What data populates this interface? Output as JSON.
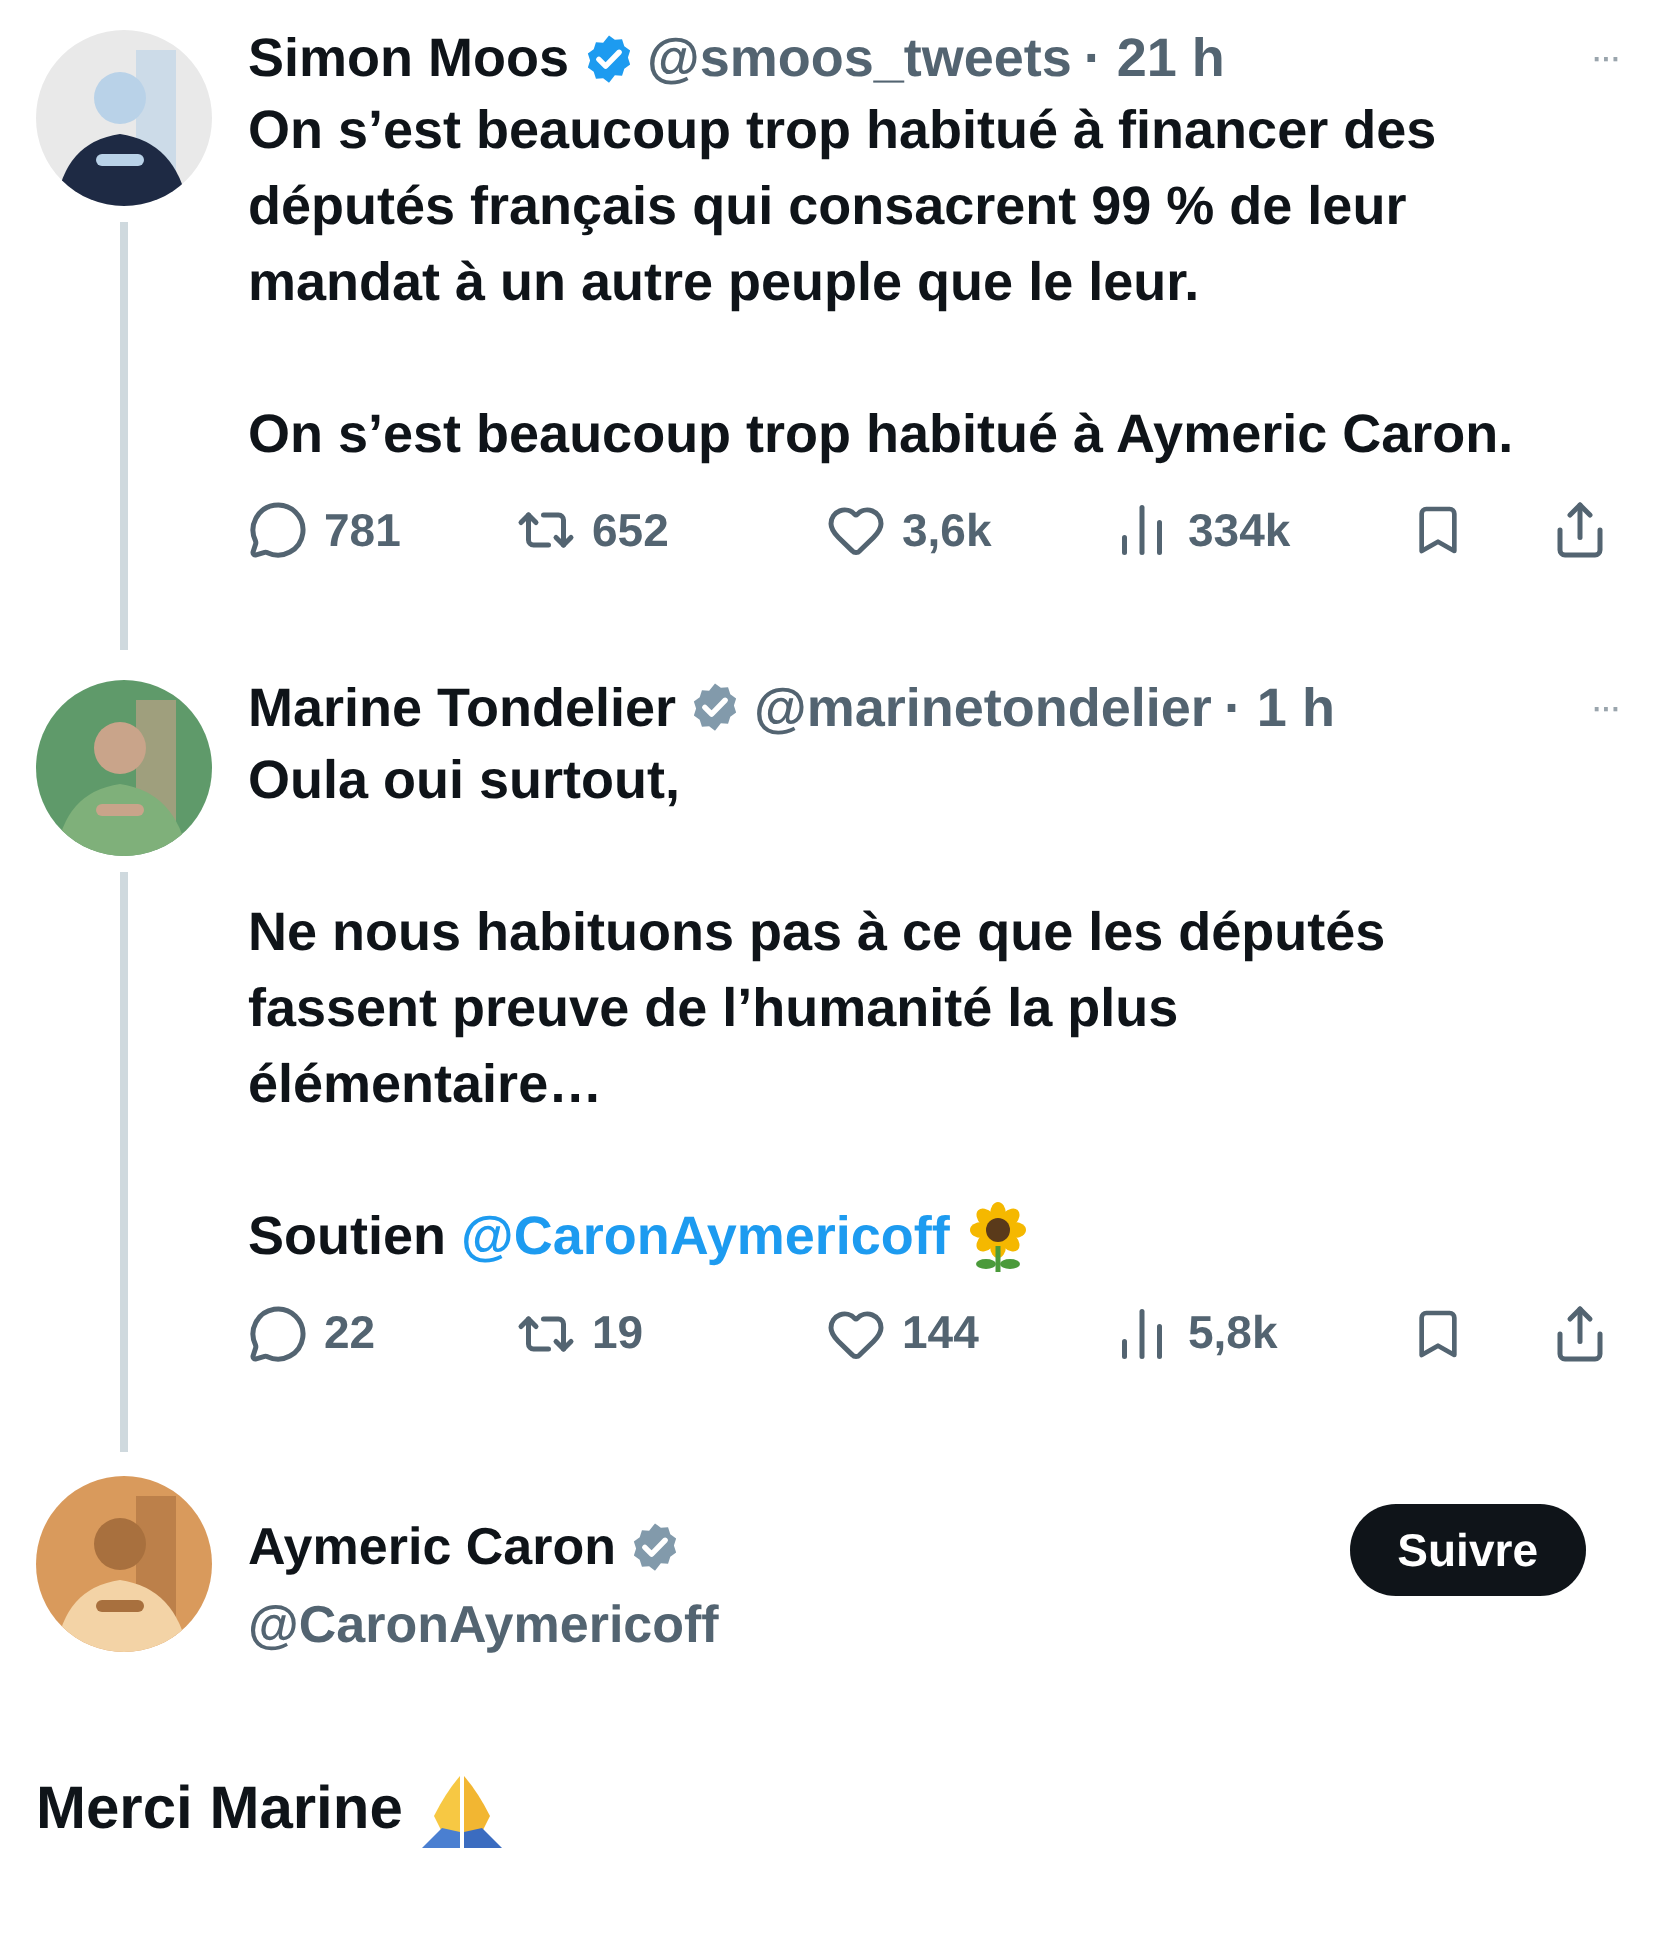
{
  "tweets": [
    {
      "name": "Simon Moos",
      "badge": {
        "kind": "blue"
      },
      "handle": "@smoos_tweets",
      "time": "· 21 h",
      "more": "···",
      "avatar": {
        "kind": "picture"
      },
      "paragraphs": [
        {
          "text": "On s’est beaucoup trop habitué à financer des députés français qui consacrent 99 % de leur mandat à un autre peuple que le leur."
        },
        {
          "text": "On s’est beaucoup trop habitué à Aymeric Caron."
        }
      ],
      "actions": {
        "replies": "781",
        "reposts": "652",
        "likes": "3,6k",
        "views": "334k"
      }
    },
    {
      "name": "Marine Tondelier",
      "badge": {
        "kind": "grey"
      },
      "handle": "@marinetondelier",
      "time": "· 1 h",
      "more": "···",
      "avatar": {
        "kind": "picture"
      },
      "paragraphs": [
        {
          "text": "Oula oui surtout,"
        },
        {
          "text": "Ne nous habituons pas à ce que les députés fassent preuve de l’humanité la plus élémentaire…"
        },
        {
          "text": "Soutien",
          "mention": "@CaronAymericoff",
          "emoji": {
            "kind": "sunflower"
          }
        }
      ],
      "actions": {
        "replies": "22",
        "reposts": "19",
        "likes": "144",
        "views": "5,8k"
      }
    }
  ],
  "main": {
    "name": "Aymeric Caron",
    "badge": {
      "kind": "grey"
    },
    "handle": "@CaronAymericoff",
    "follow": "Suivre",
    "avatar": {
      "kind": "picture"
    },
    "text": "Merci Marine",
    "emoji": {
      "kind": "pray"
    }
  }
}
